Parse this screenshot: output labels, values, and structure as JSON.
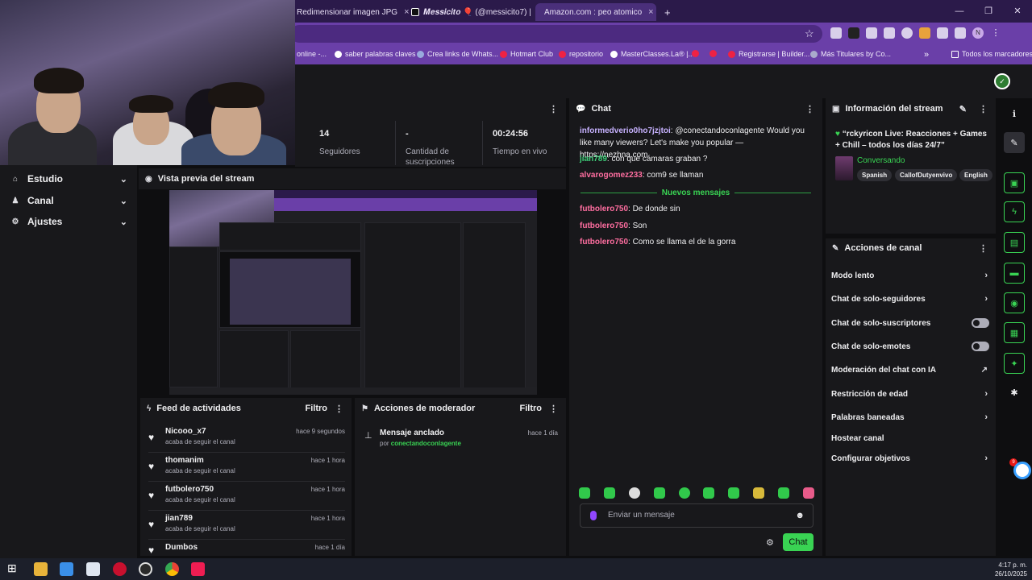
{
  "browser": {
    "tabs": [
      {
        "label": "Redimensionar imagen JPG",
        "close": "×"
      },
      {
        "label": "𝑴𝒆𝒔𝒔𝒊𝒄𝒊𝒕𝒐 🎈 (@messicito7) |",
        "close": "×"
      },
      {
        "label": "Amazon.com : peo atomico",
        "close": "×"
      }
    ],
    "new_tab": "+",
    "window_controls": [
      "—",
      "❐",
      "✕"
    ],
    "bookmarks": [
      "online -...",
      "saber palabras claves",
      "Crea links de Whats...",
      "Hotmart Club",
      "repositorio",
      "MasterClasses.La® |...",
      "Registrarse | Builder...",
      "Más Titulares by Co...",
      "»",
      "Todos los marcadores"
    ],
    "star": "☆",
    "profile": "N"
  },
  "nav": {
    "items": [
      {
        "label": "Estudio",
        "icon": "⌂"
      },
      {
        "label": "Canal",
        "icon": "♟"
      },
      {
        "label": "Ajustes",
        "icon": "⚙"
      }
    ],
    "chevron": "⌄"
  },
  "stats": [
    {
      "value": "14",
      "label": "Seguidores"
    },
    {
      "value": "-",
      "label": "Cantidad de suscripciones"
    },
    {
      "value": "00:24:56",
      "label": "Tiempo en vivo"
    }
  ],
  "preview": {
    "title": "Vista previa del stream"
  },
  "chat": {
    "title": "Chat",
    "messages": [
      {
        "user": "informedverio0ho7jzjtoi",
        "color": "#c7b2ff",
        "text": ": @conectandoconlagente Would you like many viewers? Let's make you popular — https://nezhna.com"
      },
      {
        "user": "jian789",
        "color": "#3fd17a",
        "text": ": con que cámaras graban ?"
      },
      {
        "user": "alvarogomez233",
        "color": "#ff6ea0",
        "text": ": com9 se llaman"
      },
      {
        "user": "futbolero750",
        "color": "#ff6ea0",
        "text": ": De donde sin"
      },
      {
        "user": "futbolero750",
        "color": "#ff6ea0",
        "text": ": Son"
      },
      {
        "user": "futbolero750",
        "color": "#ff6ea0",
        "text": ": Como se llama el de la gorra"
      }
    ],
    "new_messages": "Nuevos mensajes",
    "placeholder": "Enviar un mensaje",
    "send": "Chat"
  },
  "stream_info": {
    "header": "Información del stream",
    "title": "“rckyricon Live: Reacciones + Games + Chill – todos los días 24/7”",
    "category": "Conversando",
    "tags": [
      "Spanish",
      "CallofDutyenvivo",
      "English"
    ]
  },
  "channel_actions": {
    "header": "Acciones de canal",
    "items": [
      {
        "label": "Modo lento",
        "control": "›"
      },
      {
        "label": "Chat de solo-seguidores",
        "control": "›"
      },
      {
        "label": "Chat de solo-suscriptores",
        "control": "toggle"
      },
      {
        "label": "Chat de solo-emotes",
        "control": "toggle"
      },
      {
        "label": "Moderación del chat con IA",
        "control": "↗"
      },
      {
        "label": "Restricción de edad",
        "control": "›"
      },
      {
        "label": "Palabras baneadas",
        "control": "›"
      },
      {
        "label": "Hostear canal",
        "control": ""
      },
      {
        "label": "Configurar objetivos",
        "control": "›"
      }
    ]
  },
  "feed": {
    "header": "Feed de actividades",
    "filter": "Filtro",
    "items": [
      {
        "name": "Nicooo_x7",
        "desc": "acaba de seguir el canal",
        "time": "hace 9 segundos"
      },
      {
        "name": "thomanim",
        "desc": "acaba de seguir el canal",
        "time": "hace 1 hora"
      },
      {
        "name": "futbolero750",
        "desc": "acaba de seguir el canal",
        "time": "hace 1 hora"
      },
      {
        "name": "jian789",
        "desc": "acaba de seguir el canal",
        "time": "hace 1 hora"
      },
      {
        "name": "Dumbos",
        "desc": "",
        "time": "hace 1 día"
      }
    ]
  },
  "mod_actions": {
    "header": "Acciones de moderador",
    "filter": "Filtro",
    "title": "Mensaje anclado",
    "by": "por ",
    "by_user": "conectandoconlagente",
    "time": "hace 1 día"
  },
  "taskbar": {
    "time": "4:17 p. m.",
    "date": "26/10/2025"
  },
  "notif_count": "9",
  "colors": {
    "accent": "#39d353",
    "purple": "#6a3fa8",
    "panel": "#18181b"
  }
}
